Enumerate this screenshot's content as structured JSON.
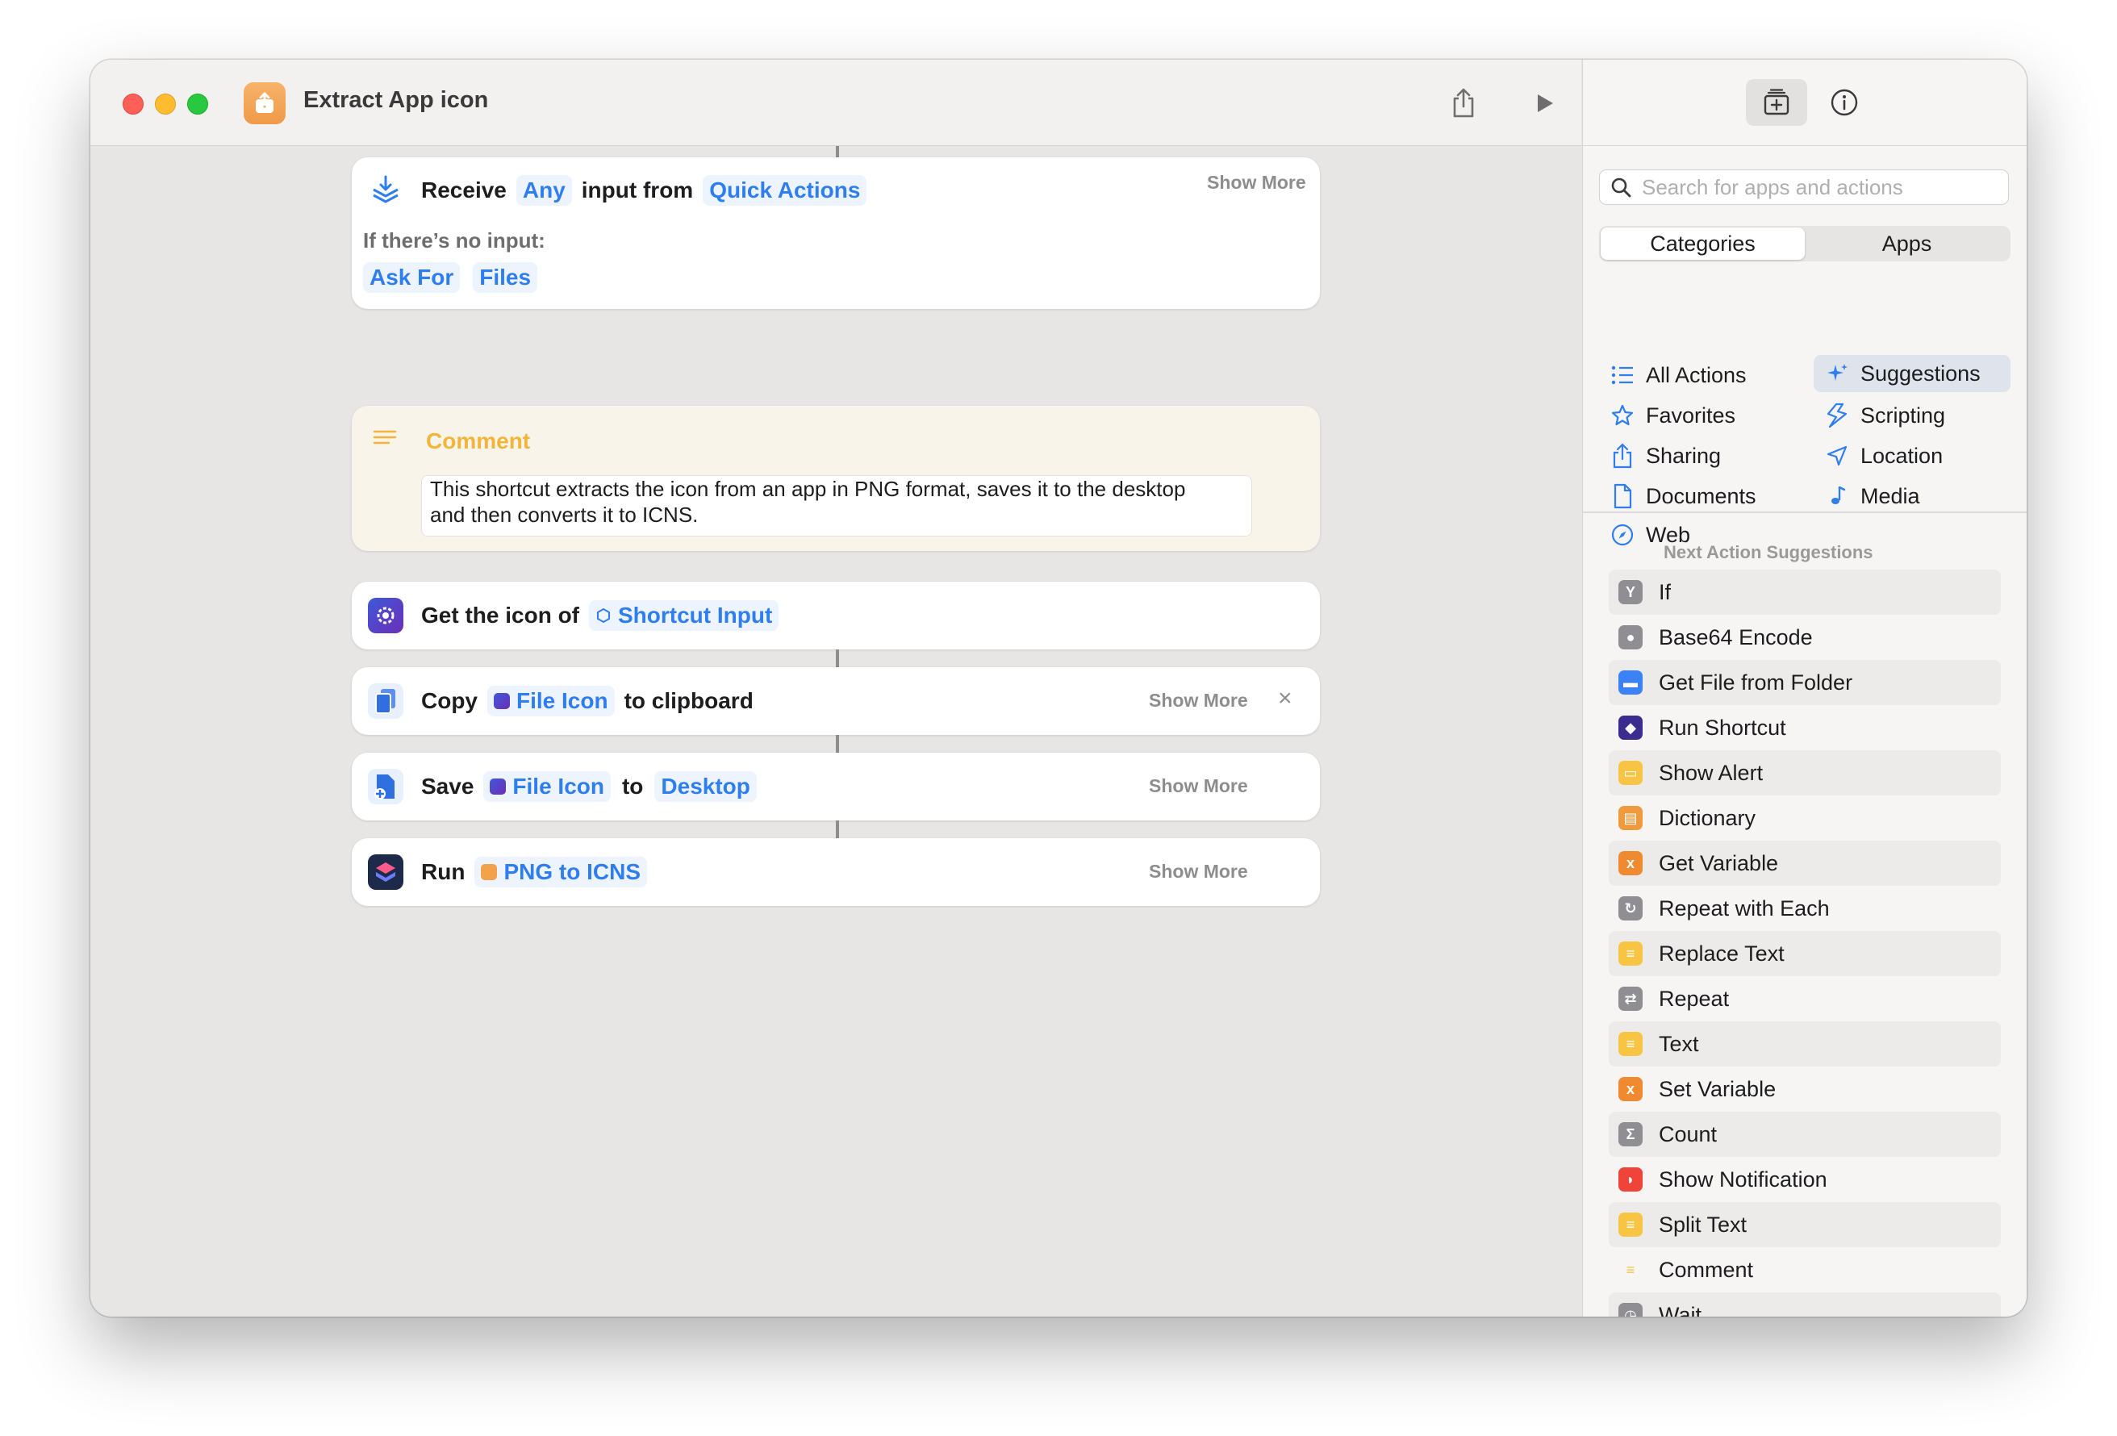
{
  "window": {
    "title": "Extract App icon"
  },
  "editor": {
    "receive": {
      "verb": "Receive",
      "type_token": "Any",
      "middle": "input from",
      "source_token": "Quick Actions",
      "show_more": "Show More",
      "no_input_label": "If there’s no input:",
      "no_input_action": "Ask For",
      "no_input_type": "Files"
    },
    "comment": {
      "label": "Comment",
      "line1": "This shortcut extracts the icon from an app in PNG format, saves it to the desktop",
      "line2": "and then converts it to ICNS."
    },
    "get_icon": {
      "label": "Get the icon of",
      "token": "Shortcut Input"
    },
    "copy": {
      "verb": "Copy",
      "token": "File Icon",
      "suffix": "to clipboard",
      "show_more": "Show More",
      "close": "×"
    },
    "save": {
      "verb": "Save",
      "token": "File Icon",
      "middle": "to",
      "dest_token": "Desktop",
      "show_more": "Show More"
    },
    "run": {
      "verb": "Run",
      "token": "PNG to ICNS",
      "show_more": "Show More"
    }
  },
  "sidebar": {
    "search_placeholder": "Search for apps and actions",
    "segments": [
      "Categories",
      "Apps"
    ],
    "categories": {
      "all_actions": "All Actions",
      "favorites": "Favorites",
      "sharing": "Sharing",
      "documents": "Documents",
      "web": "Web",
      "suggestions": "Suggestions",
      "scripting": "Scripting",
      "location": "Location",
      "media": "Media"
    },
    "next_title": "Next Action Suggestions",
    "suggestions": [
      {
        "label": "If",
        "icon": "if-icon",
        "color": "#8e8e93"
      },
      {
        "label": "Base64 Encode",
        "icon": "base64-icon",
        "color": "#8e8e93"
      },
      {
        "label": "Get File from Folder",
        "icon": "folder-icon",
        "color": "#3b82f6"
      },
      {
        "label": "Run Shortcut",
        "icon": "shortcuts-icon",
        "color": "#3b2d8f"
      },
      {
        "label": "Show Alert",
        "icon": "alert-icon",
        "color": "#f7c443"
      },
      {
        "label": "Dictionary",
        "icon": "dictionary-icon",
        "color": "#f09a3e"
      },
      {
        "label": "Get Variable",
        "icon": "variable-icon",
        "color": "#f08a30"
      },
      {
        "label": "Repeat with Each",
        "icon": "repeat-each-icon",
        "color": "#8e8e93"
      },
      {
        "label": "Replace Text",
        "icon": "text-icon",
        "color": "#f7c443"
      },
      {
        "label": "Repeat",
        "icon": "repeat-icon",
        "color": "#8e8e93"
      },
      {
        "label": "Text",
        "icon": "text-icon",
        "color": "#f7c443"
      },
      {
        "label": "Set Variable",
        "icon": "variable-icon",
        "color": "#f08a30"
      },
      {
        "label": "Count",
        "icon": "sigma-icon",
        "color": "#8e8e93"
      },
      {
        "label": "Show Notification",
        "icon": "notification-icon",
        "color": "#f0443a"
      },
      {
        "label": "Split Text",
        "icon": "text-icon",
        "color": "#f7c443"
      },
      {
        "label": "Comment",
        "icon": "comment-icon",
        "color": "#f7c443"
      },
      {
        "label": "Wait",
        "icon": "wait-icon",
        "color": "#8e8e93"
      }
    ]
  },
  "colors": {
    "accent": "#2f7ef0",
    "comment_label": "#f2b43a"
  }
}
